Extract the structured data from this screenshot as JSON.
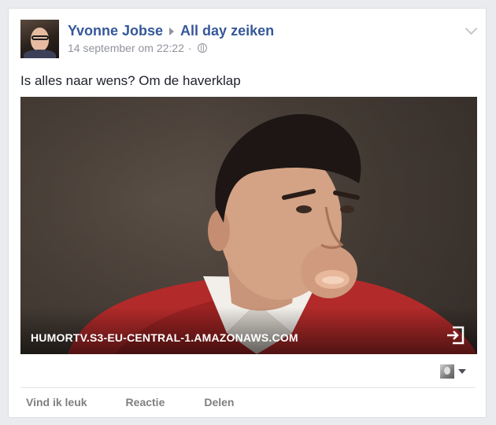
{
  "post": {
    "author": "Yvonne Jobse",
    "group": "All day zeiken",
    "timestamp": "14 september om 22:22",
    "separator": "·",
    "privacy_icon": "globe-icon",
    "text": "Is alles naar wens? Om de haverklap"
  },
  "link_preview": {
    "domain": "HUMORTV.S3-EU-CENTRAL-1.AMAZONAWS.COM",
    "action_icon": "open-link-icon"
  },
  "audience": {
    "icon": "audience-avatar-icon",
    "dropdown_icon": "caret-down-icon"
  },
  "actions": {
    "like": "Vind ik leuk",
    "comment": "Reactie",
    "share": "Delen"
  },
  "colors": {
    "link_blue": "#365899",
    "meta_gray": "#90949c",
    "action_gray": "#7f7f7f",
    "page_bg": "#e9ebee"
  }
}
